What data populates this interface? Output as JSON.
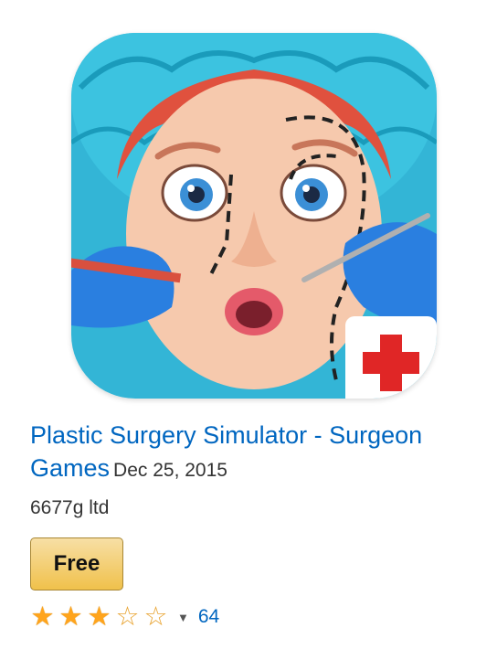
{
  "product": {
    "title": "Plastic Surgery Simulator - Surgeon Games",
    "date": "Dec 25, 2015",
    "developer": "6677g ltd",
    "price_label": "Free",
    "rating": {
      "stars": 3,
      "max_stars": 5,
      "review_count": "64"
    }
  },
  "colors": {
    "link": "#0066c0",
    "button_top": "#f7dfa5",
    "button_bottom": "#f0c14b",
    "star": "#ffa41c"
  }
}
